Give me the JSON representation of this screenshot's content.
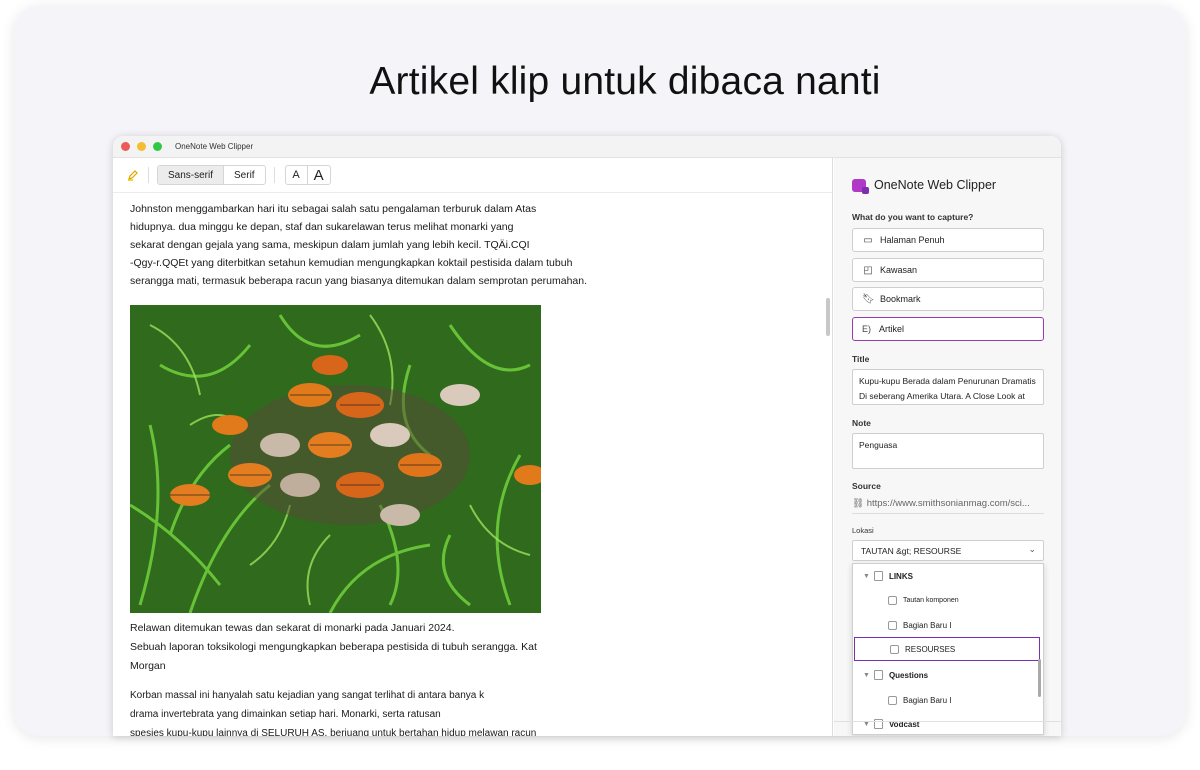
{
  "headline": "Artikel klip untuk dibaca nanti",
  "window": {
    "title": "OneNote Web Clipper"
  },
  "toolbar": {
    "font_sans": "Sans-serif",
    "font_serif": "Serif",
    "size_small": "A",
    "size_large": "A",
    "highlighter_icon": "highlighter-pen-icon"
  },
  "article": {
    "lines": [
      "Johnston menggambarkan hari itu sebagai salah satu pengalaman terburuk dalam        Atas",
      "hidupnya. dua minggu ke depan, staf dan sukarelawan terus melihat monarki yang",
      "sekarat dengan gejala yang sama, meskipun dalam jumlah yang lebih kecil. TQÄi.CQI",
      "-Qgy-r.QQEt yang diterbitkan setahun kemudian mengungkapkan koktail pestisida dalam tubuh",
      "serangga mati, termasuk beberapa racun yang biasanya ditemukan dalam semprotan perumahan."
    ],
    "caption_lines": [
      "Relawan ditemukan tewas dan sekarat di monarki pada Januari 2024.",
      "Sebuah laporan toksikologi mengungkapkan beberapa pestisida di tubuh serangga.     Kat",
      "Morgan"
    ],
    "para2_lines": [
      "Korban massal ini hanyalah satu kejadian yang sangat terlihat di antara banya k",
      "drama invertebrata yang dimainkan setiap hari. Monarki, serta ratusan",
      "spesies kupu-kupu lainnya di SELURUH AS, berjuang untuk bertahan hidup melawan racun"
    ]
  },
  "panel": {
    "brand": "OneNote Web Clipper",
    "capture_label": "What do you want to capture?",
    "options": [
      {
        "label": "Halaman Penuh",
        "icon": "full-page-icon"
      },
      {
        "label": "Kawasan",
        "icon": "region-icon"
      },
      {
        "label": "Bookmark",
        "icon": "bookmark-icon"
      },
      {
        "label": "Artikel",
        "icon": "article-icon",
        "prefix": "E)"
      }
    ],
    "title_label": "Title",
    "title_value_1": "Kupu-kupu Berada dalam Penurunan Dramatis",
    "title_value_2": "Di seberang Amerika Utara. A Close Look at",
    "note_label": "Note",
    "note_value": "Penguasa",
    "source_label": "Source",
    "source_value": "https://www.smithsonianmag.com/sci...",
    "location_label": "Lokasi",
    "location_value": "TAUTAN &gt; RESOURSE",
    "tree": [
      {
        "type": "section",
        "label": "LINKS"
      },
      {
        "type": "page",
        "label": "Tautan komponen"
      },
      {
        "type": "page",
        "label": "Bagian Baru I"
      },
      {
        "type": "page",
        "label": "RESOURSES",
        "selected": true
      },
      {
        "type": "section",
        "label": "Questions"
      },
      {
        "type": "page",
        "label": "Bagian Baru I"
      },
      {
        "type": "section",
        "label": "Vodcast"
      }
    ]
  },
  "colors": {
    "accent": "#9a3ab0",
    "brand": "#b03ac7"
  }
}
